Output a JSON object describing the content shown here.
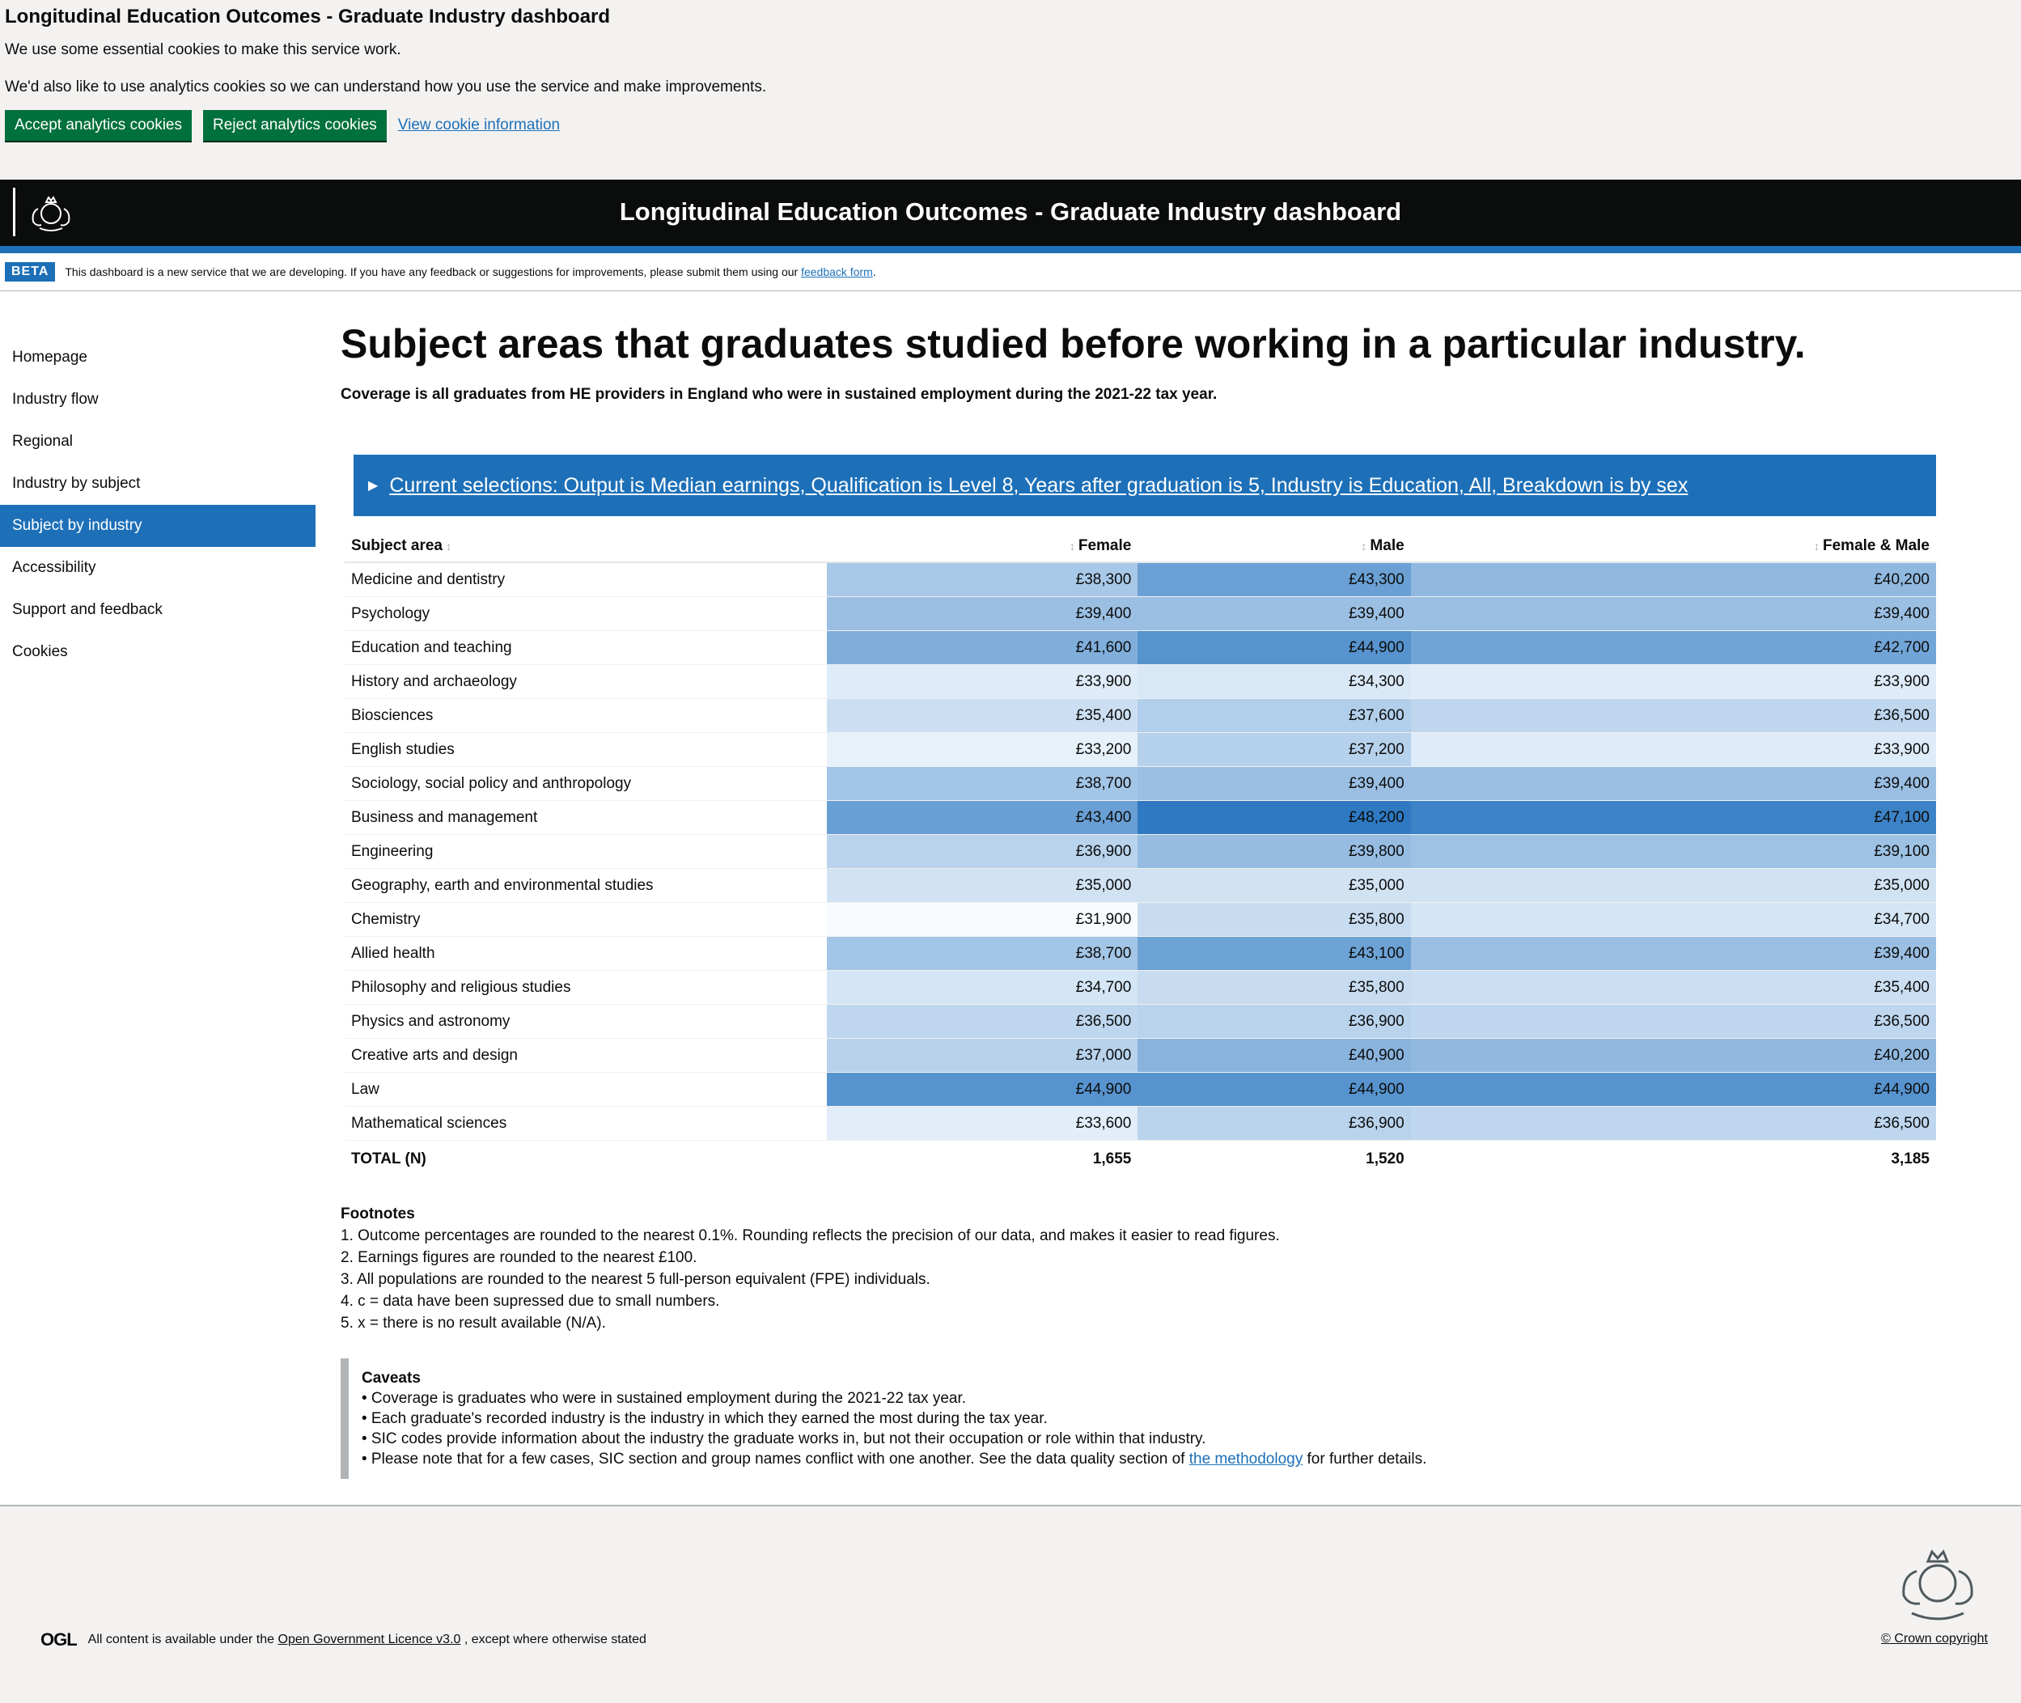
{
  "cookie_banner": {
    "title": "Longitudinal Education Outcomes - Graduate Industry dashboard",
    "line1": "We use some essential cookies to make this service work.",
    "line2": "We'd also like to use analytics cookies so we can understand how you use the service and make improvements.",
    "accept_label": "Accept analytics cookies",
    "reject_label": "Reject analytics cookies",
    "info_label": "View cookie information"
  },
  "header": {
    "title": "Longitudinal Education Outcomes - Graduate Industry dashboard"
  },
  "beta": {
    "tag": "BETA",
    "text": "This dashboard is a new service that we are developing. If you have any feedback or suggestions for improvements, please submit them using our",
    "link": "feedback form",
    "end": "."
  },
  "nav": {
    "items": [
      {
        "label": "Homepage",
        "active": false
      },
      {
        "label": "Industry flow",
        "active": false
      },
      {
        "label": "Regional",
        "active": false
      },
      {
        "label": "Industry by subject",
        "active": false
      },
      {
        "label": "Subject by industry",
        "active": true
      },
      {
        "label": "Accessibility",
        "active": false
      },
      {
        "label": "Support and feedback",
        "active": false
      },
      {
        "label": "Cookies",
        "active": false
      }
    ]
  },
  "page": {
    "title": "Subject areas that graduates studied before working in a particular industry.",
    "coverage": "Coverage is all graduates from HE providers in England who were in sustained employment during the 2021-22 tax year.",
    "selections": "Current selections: Output is Median earnings, Qualification is Level 8, Years after graduation is 5, Industry is Education, All, Breakdown is by sex"
  },
  "table": {
    "headers": [
      "Subject area",
      "Female",
      "Male",
      "Female & Male"
    ],
    "rows": [
      {
        "subject": "Medicine and dentistry",
        "female": "£38,300",
        "male": "£43,300",
        "both": "£40,200",
        "v": [
          38300,
          43300,
          40200
        ]
      },
      {
        "subject": "Psychology",
        "female": "£39,400",
        "male": "£39,400",
        "both": "£39,400",
        "v": [
          39400,
          39400,
          39400
        ]
      },
      {
        "subject": "Education and teaching",
        "female": "£41,600",
        "male": "£44,900",
        "both": "£42,700",
        "v": [
          41600,
          44900,
          42700
        ]
      },
      {
        "subject": "History and archaeology",
        "female": "£33,900",
        "male": "£34,300",
        "both": "£33,900",
        "v": [
          33900,
          34300,
          33900
        ]
      },
      {
        "subject": "Biosciences",
        "female": "£35,400",
        "male": "£37,600",
        "both": "£36,500",
        "v": [
          35400,
          37600,
          36500
        ]
      },
      {
        "subject": "English studies",
        "female": "£33,200",
        "male": "£37,200",
        "both": "£33,900",
        "v": [
          33200,
          37200,
          33900
        ]
      },
      {
        "subject": "Sociology, social policy and anthropology",
        "female": "£38,700",
        "male": "£39,400",
        "both": "£39,400",
        "v": [
          38700,
          39400,
          39400
        ]
      },
      {
        "subject": "Business and management",
        "female": "£43,400",
        "male": "£48,200",
        "both": "£47,100",
        "v": [
          43400,
          48200,
          47100
        ]
      },
      {
        "subject": "Engineering",
        "female": "£36,900",
        "male": "£39,800",
        "both": "£39,100",
        "v": [
          36900,
          39800,
          39100
        ]
      },
      {
        "subject": "Geography, earth and environmental studies",
        "female": "£35,000",
        "male": "£35,000",
        "both": "£35,000",
        "v": [
          35000,
          35000,
          35000
        ]
      },
      {
        "subject": "Chemistry",
        "female": "£31,900",
        "male": "£35,800",
        "both": "£34,700",
        "v": [
          31900,
          35800,
          34700
        ]
      },
      {
        "subject": "Allied health",
        "female": "£38,700",
        "male": "£43,100",
        "both": "£39,400",
        "v": [
          38700,
          43100,
          39400
        ]
      },
      {
        "subject": "Philosophy and religious studies",
        "female": "£34,700",
        "male": "£35,800",
        "both": "£35,400",
        "v": [
          34700,
          35800,
          35400
        ]
      },
      {
        "subject": "Physics and astronomy",
        "female": "£36,500",
        "male": "£36,900",
        "both": "£36,500",
        "v": [
          36500,
          36900,
          36500
        ]
      },
      {
        "subject": "Creative arts and design",
        "female": "£37,000",
        "male": "£40,900",
        "both": "£40,200",
        "v": [
          37000,
          40900,
          40200
        ]
      },
      {
        "subject": "Law",
        "female": "£44,900",
        "male": "£44,900",
        "both": "£44,900",
        "v": [
          44900,
          44900,
          44900
        ]
      },
      {
        "subject": "Mathematical sciences",
        "female": "£33,600",
        "male": "£36,900",
        "both": "£36,500",
        "v": [
          33600,
          36900,
          36500
        ]
      }
    ],
    "total": {
      "label": "TOTAL (N)",
      "female": "1,655",
      "male": "1,520",
      "both": "3,185"
    },
    "scale": {
      "min": 31900,
      "max": 48200,
      "low_color": "#f7fbff",
      "high_color": "#2e79c2"
    }
  },
  "footnotes": {
    "title": "Footnotes",
    "items": [
      "1. Outcome percentages are rounded to the nearest 0.1%. Rounding reflects the precision of our data, and makes it easier to read figures.",
      "2. Earnings figures are rounded to the nearest £100.",
      "3. All populations are rounded to the nearest 5 full-person equivalent (FPE) individuals.",
      "4. c = data have been supressed due to small numbers.",
      "5. x = there is no result available (N/A)."
    ]
  },
  "caveats": {
    "title": "Caveats",
    "items": [
      "• Coverage is graduates who were in sustained employment during the 2021-22 tax year.",
      "• Each graduate's recorded industry is the industry in which they earned the most during the tax year.",
      "• SIC codes provide information about the industry the graduate works in, but not their occupation or role within that industry."
    ],
    "last_pre": "• Please note that for a few cases, SIC section and group names conflict with one another. See the data quality section of",
    "last_link": "the methodology",
    "last_post": "for further details."
  },
  "footer": {
    "ogl_logo": "OGL",
    "licence_pre": "All content is available under the",
    "licence_link": "Open Government Licence v3.0",
    "licence_post": ", except where otherwise stated",
    "copyright": "© Crown copyright"
  }
}
